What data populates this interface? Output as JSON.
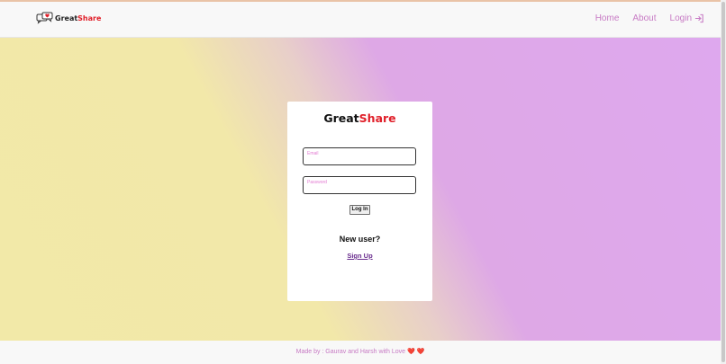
{
  "navbar": {
    "brand_primary": "Great",
    "brand_accent": "Share",
    "brand_icon": "chat-heart-icon",
    "links": {
      "home": "Home",
      "about": "About",
      "login": "Login"
    },
    "login_icon": "login-arrow-icon"
  },
  "card": {
    "title_primary": "Great",
    "title_accent": "Share",
    "email_label": "Email",
    "password_label": "Password",
    "login_button": "Log In",
    "new_user_text": "New user?",
    "signup_link": "Sign Up"
  },
  "footer": {
    "text": "Made by : Gaurav and Harsh with Love ",
    "hearts": "❤️ ❤️"
  },
  "colors": {
    "accent_red": "#e0202a",
    "nav_link": "#c77ac4",
    "signup_link": "#6a2d8e",
    "gradient_start": "#f2e9a8",
    "gradient_end": "#dea8ee"
  }
}
